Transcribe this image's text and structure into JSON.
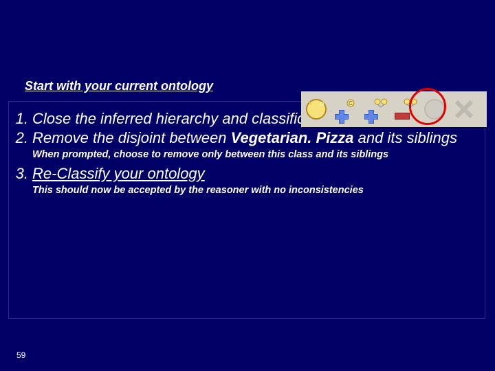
{
  "intro": "Start with your current ontology",
  "steps": {
    "s1": {
      "num": "1.",
      "text": "Close the inferred hierarchy and classification results pane"
    },
    "s2": {
      "num": "2.",
      "pre": "Remove the disjoint between ",
      "bold": "Vegetarian. Pizza",
      "post": " and its siblings"
    },
    "s2_note": "When prompted, choose to remove only between this class and its siblings",
    "s3": {
      "num": "3.",
      "text": "Re-Classify your ontology"
    },
    "s3_note": "This should now be accepted by the reasoner with no inconsistencies"
  },
  "page_number": "59",
  "toolbar_icons": [
    "create-class",
    "add-subclass",
    "add-sibling",
    "remove-disjoint",
    "delete-class",
    "cut-class"
  ]
}
